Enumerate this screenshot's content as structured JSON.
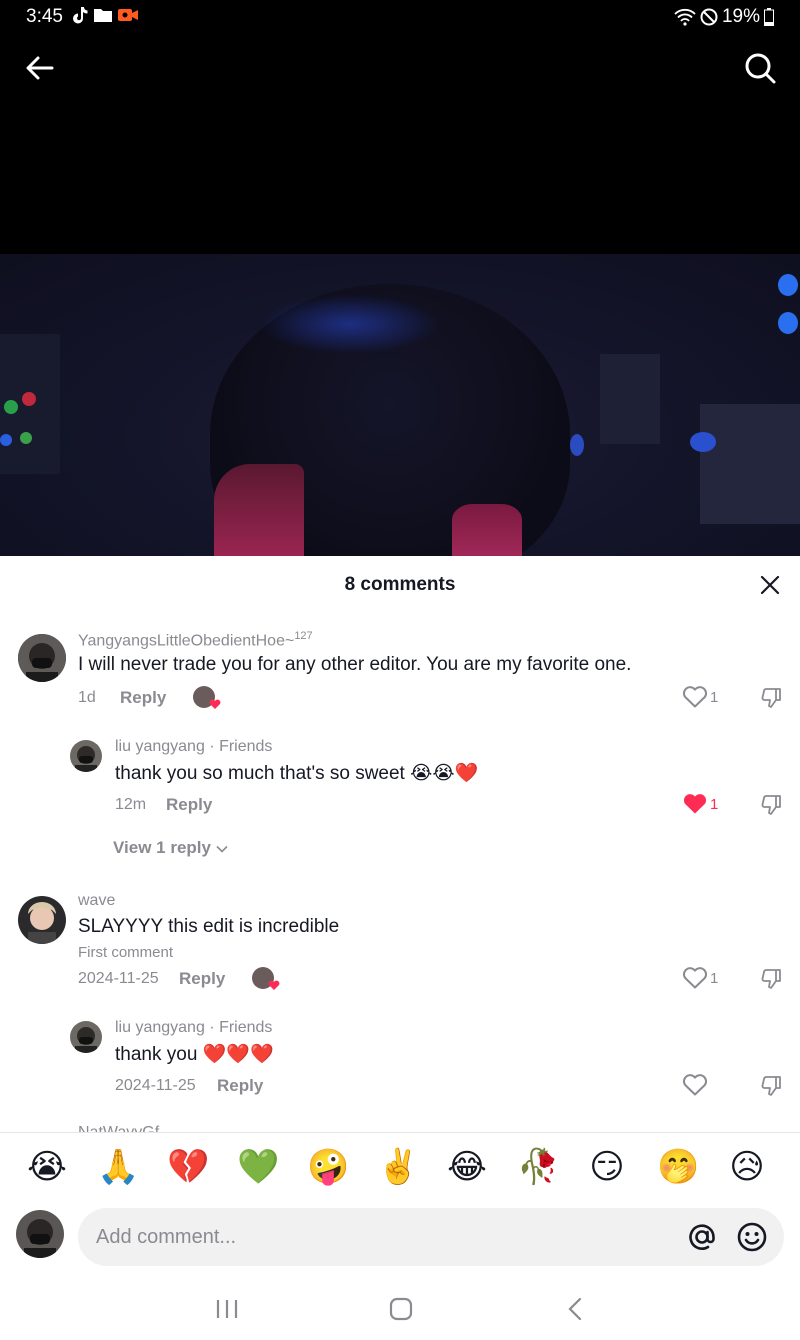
{
  "status_bar": {
    "time": "3:45",
    "battery": "19%"
  },
  "sheet": {
    "title": "8 comments"
  },
  "comments": [
    {
      "username": "YangyangsLittleObedientHoe~",
      "username_sup": "127",
      "text": "I will never trade you for any other editor. You are my favorite one.",
      "time": "1d",
      "reply_label": "Reply",
      "likes": "1"
    },
    {
      "username": "liu yangyang · Friends",
      "text": "thank you so much that's so sweet 😭😭❤️",
      "time": "12m",
      "reply_label": "Reply",
      "likes": "1",
      "view_replies": "View 1 reply"
    },
    {
      "username": "wave",
      "text": "SLAYYYY this edit is incredible",
      "badge": "First comment",
      "time": "2024-11-25",
      "reply_label": "Reply",
      "likes": "1"
    },
    {
      "username": "liu yangyang · Friends",
      "text": "thank you ❤️❤️❤️",
      "time": "2024-11-25",
      "reply_label": "Reply"
    }
  ],
  "partial_next_username": "NatWavyGf",
  "emoji_bar": [
    "😭",
    "🙏",
    "💔",
    "💚",
    "🤪",
    "✌️",
    "😂",
    "🥀",
    "😏",
    "🤭",
    "😥"
  ],
  "input": {
    "placeholder": "Add comment..."
  },
  "colors": {
    "like_active": "#fe2c55",
    "muted_text": "#8a8b91",
    "primary_text": "#161823"
  }
}
